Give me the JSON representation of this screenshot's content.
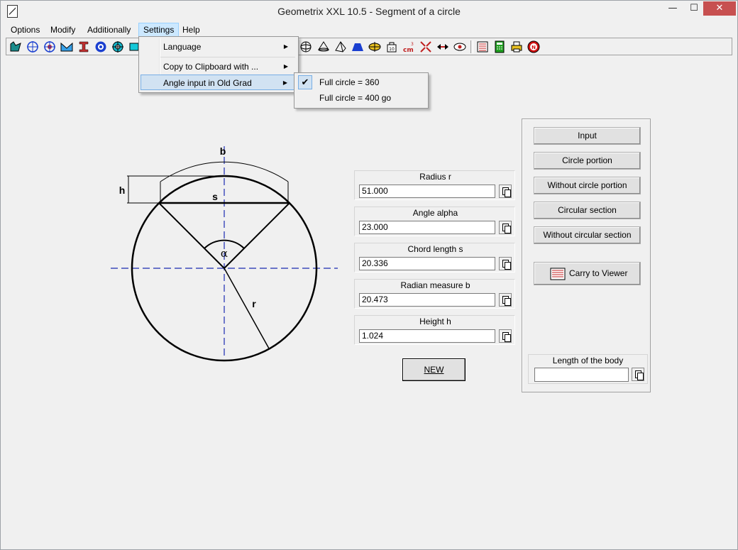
{
  "window": {
    "title": "Geometrix XXL 10.5 - Segment of a circle"
  },
  "title_buttons": {
    "minimize": "—",
    "maximize": "☐",
    "close": "✕"
  },
  "menubar": [
    "Options",
    "Modify",
    "Additionally",
    "Settings",
    "Help"
  ],
  "dropdown": {
    "items": [
      {
        "label": "Language"
      },
      {
        "label": "Copy to Clipboard with ..."
      },
      {
        "label": "Angle input in Old Grad"
      }
    ],
    "submenu": [
      {
        "label": "Full circle = 360",
        "checked": true
      },
      {
        "label": "Full circle = 400 go",
        "checked": false
      }
    ]
  },
  "diagram": {
    "label_b": "b",
    "label_h": "h",
    "label_s": "s",
    "label_alpha": "α",
    "label_r": "r"
  },
  "fields": [
    {
      "label": "Radius r",
      "value": "51.000"
    },
    {
      "label": "Angle alpha",
      "value": "23.000"
    },
    {
      "label": "Chord length s",
      "value": "20.336"
    },
    {
      "label": "Radian measure b",
      "value": "20.473"
    },
    {
      "label": "Height h",
      "value": "1.024"
    }
  ],
  "new_button": "NEW",
  "right_panel": {
    "buttons": [
      "Input",
      "Circle portion",
      "Without circle portion",
      "Circular section",
      "Without circular section"
    ],
    "carry_button": "Carry to Viewer",
    "body_label": "Length of the body",
    "body_value": ""
  },
  "toolbar_icons": [
    "segment-tool-icon",
    "circle-crosshair-icon",
    "circle-target-icon",
    "m-shape-icon",
    "i-beam-icon",
    "circle-dot-icon",
    "circle-ring-icon",
    "rectangle-icon",
    "sphere-icon",
    "cone-icon",
    "pyramid-icon",
    "frustum-icon",
    "ellipsoid-icon",
    "calculator-key-icon",
    "unit-cm-icon",
    "angles-icon",
    "arrows-icon",
    "eye-icon",
    "list-icon",
    "calculator-icon",
    "printer-icon",
    "stop-icon"
  ]
}
